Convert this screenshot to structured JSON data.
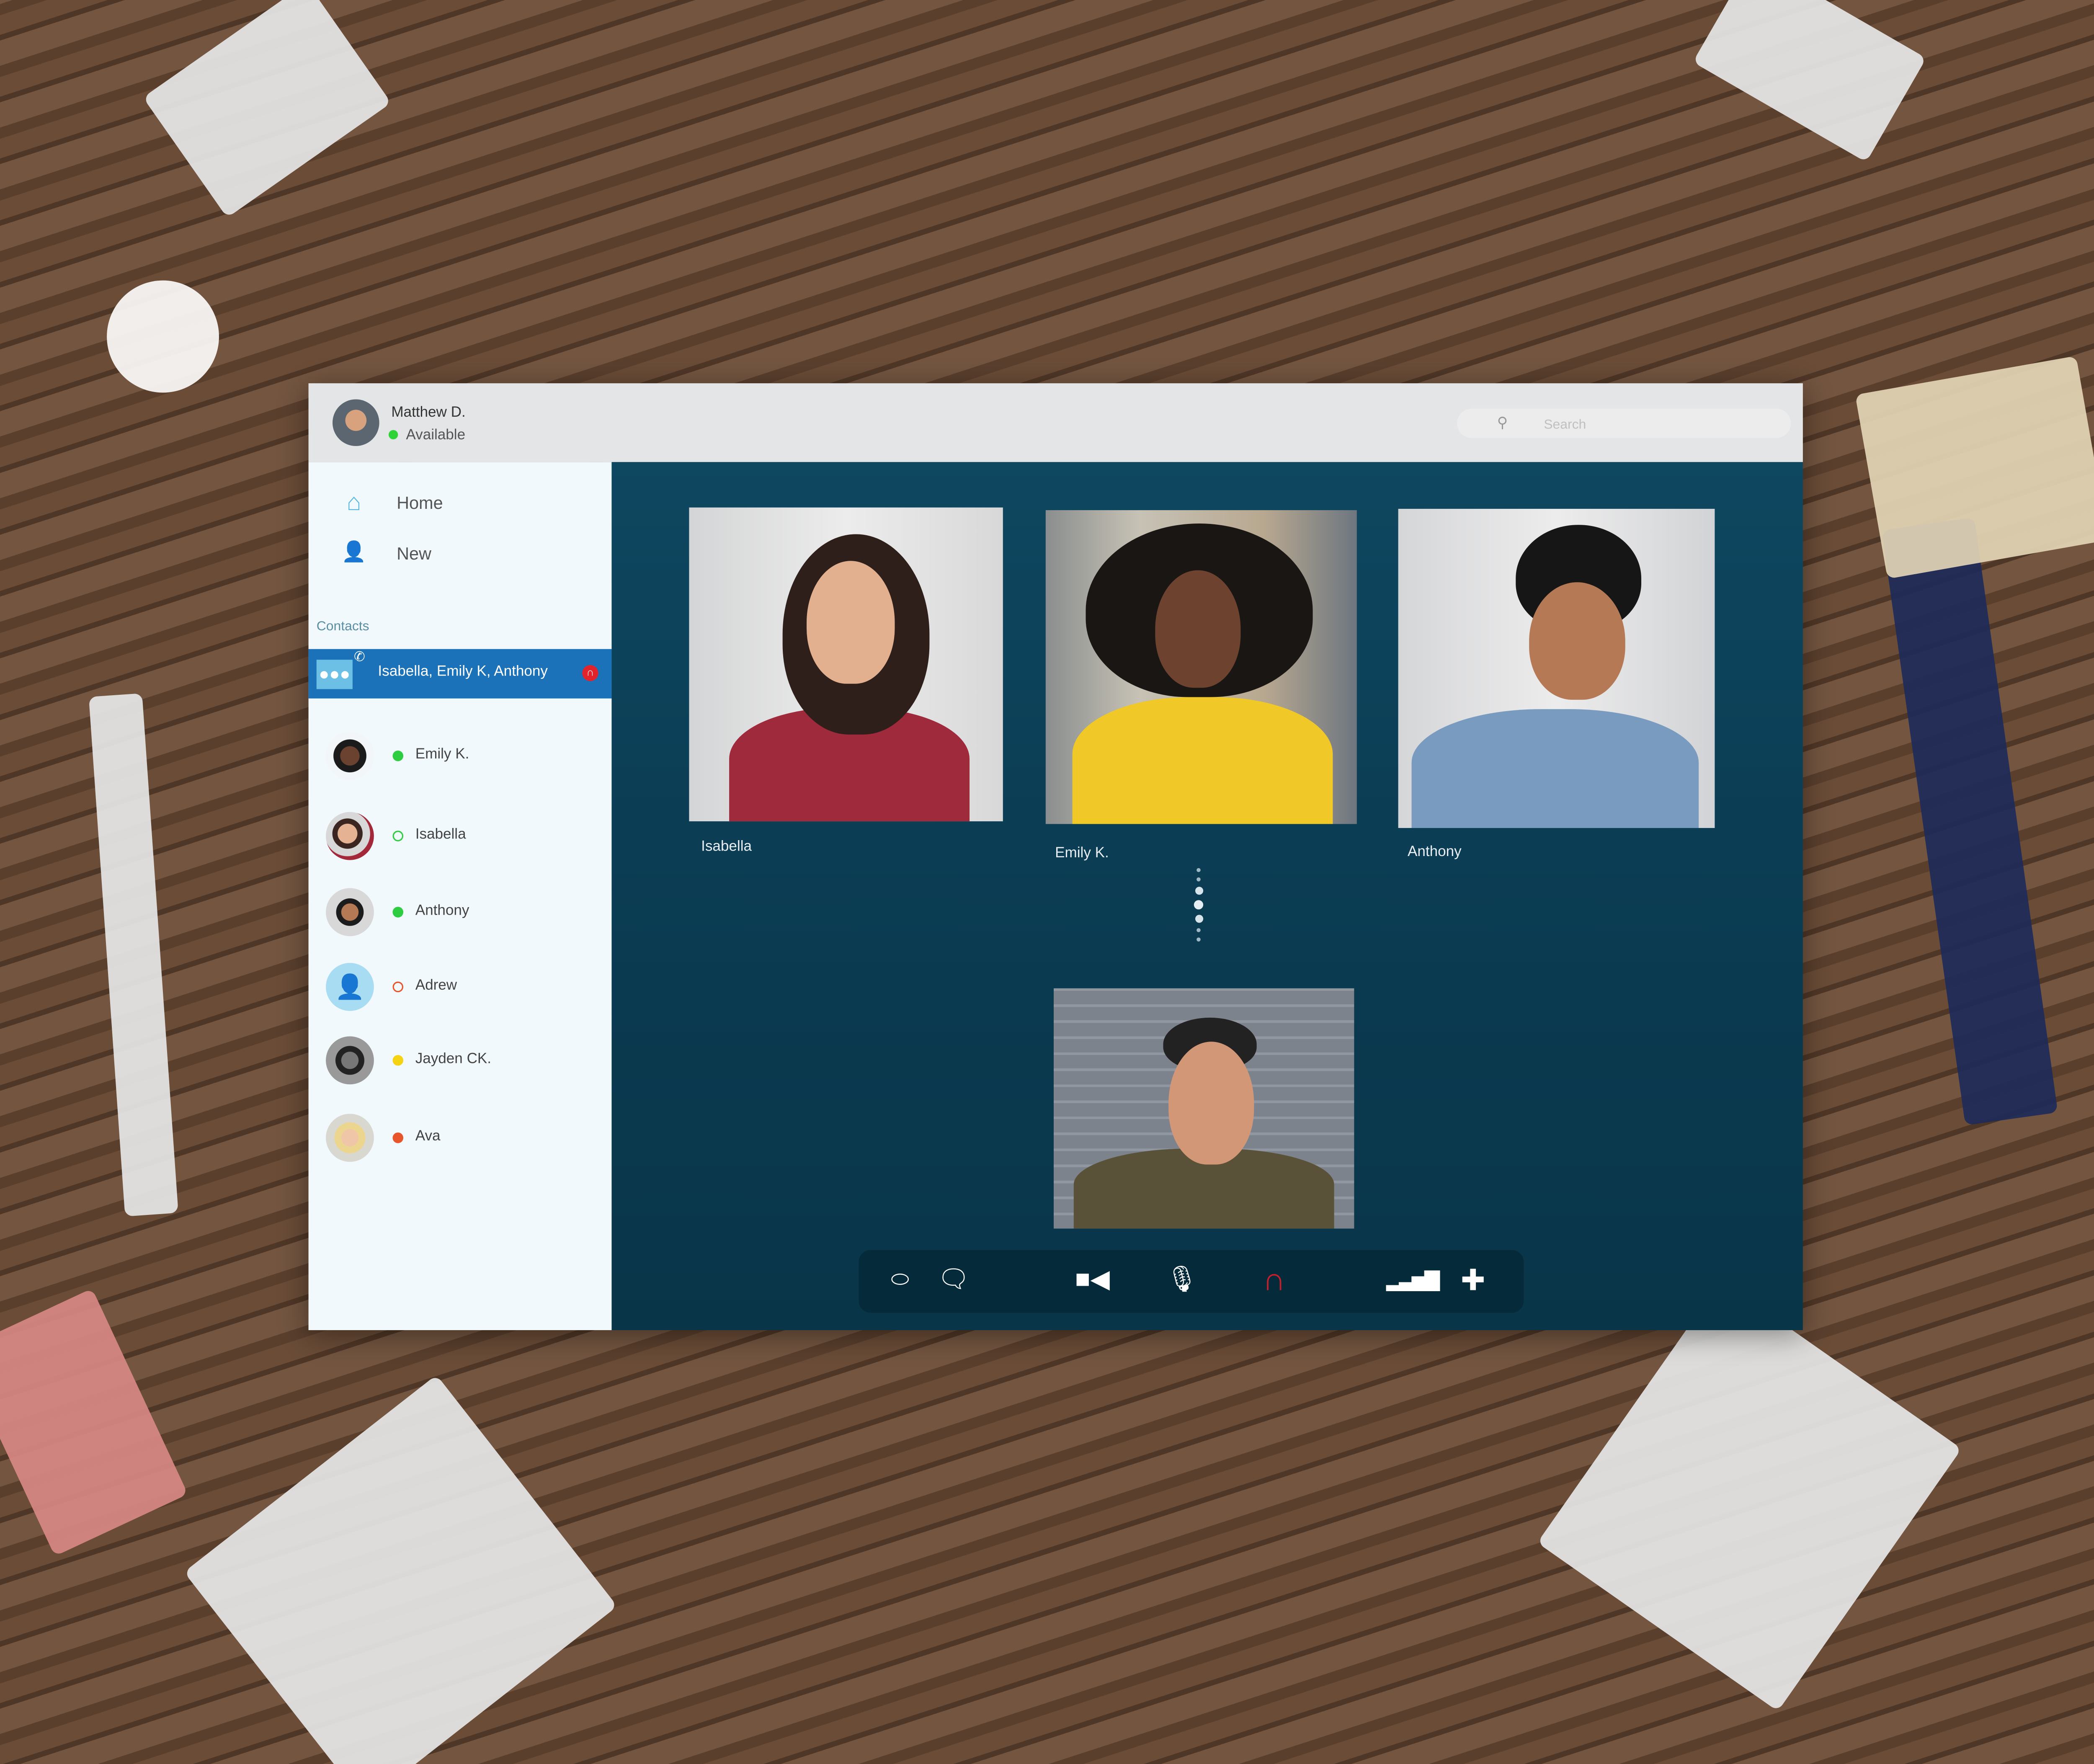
{
  "header": {
    "user_name": "Matthew D.",
    "user_status": "Available",
    "status_color": "#2ed33a",
    "search_placeholder": "Search"
  },
  "sidebar": {
    "nav": [
      {
        "label": "Home",
        "icon": "home-icon"
      },
      {
        "label": "New",
        "icon": "add-user-icon"
      }
    ],
    "contacts_label": "Contacts",
    "active_call": {
      "label": "Isabella, Emily K, Anthony",
      "icon": "group-call-icon",
      "end_icon": "hang-up-icon"
    },
    "contacts": [
      {
        "name": "Emily K.",
        "status": "online",
        "color": "#2ecc40",
        "hollow": false
      },
      {
        "name": "Isabella",
        "status": "offline",
        "color": "#2ecc40",
        "hollow": true
      },
      {
        "name": "Anthony",
        "status": "online",
        "color": "#2ecc40",
        "hollow": false
      },
      {
        "name": "Adrew",
        "status": "offline",
        "color": "#e8552a",
        "hollow": true
      },
      {
        "name": "Jayden CK.",
        "status": "away",
        "color": "#f5d312",
        "hollow": false
      },
      {
        "name": "Ava",
        "status": "busy",
        "color": "#e8552a",
        "hollow": false
      }
    ]
  },
  "call": {
    "participants": [
      {
        "name": "Isabella"
      },
      {
        "name": "Emily K."
      },
      {
        "name": "Anthony"
      }
    ],
    "self_view": true
  },
  "controls": [
    {
      "icon": "exit-icon"
    },
    {
      "icon": "chat-icon"
    },
    {
      "icon": "video-camera-icon"
    },
    {
      "icon": "microphone-icon"
    },
    {
      "icon": "hang-up-icon",
      "color": "#c0202c"
    },
    {
      "icon": "signal-volume-icon"
    },
    {
      "icon": "add-icon"
    }
  ],
  "colors": {
    "accent": "#1c72b8",
    "main_bg": "#0d4760",
    "control_bar": "#052a39"
  }
}
